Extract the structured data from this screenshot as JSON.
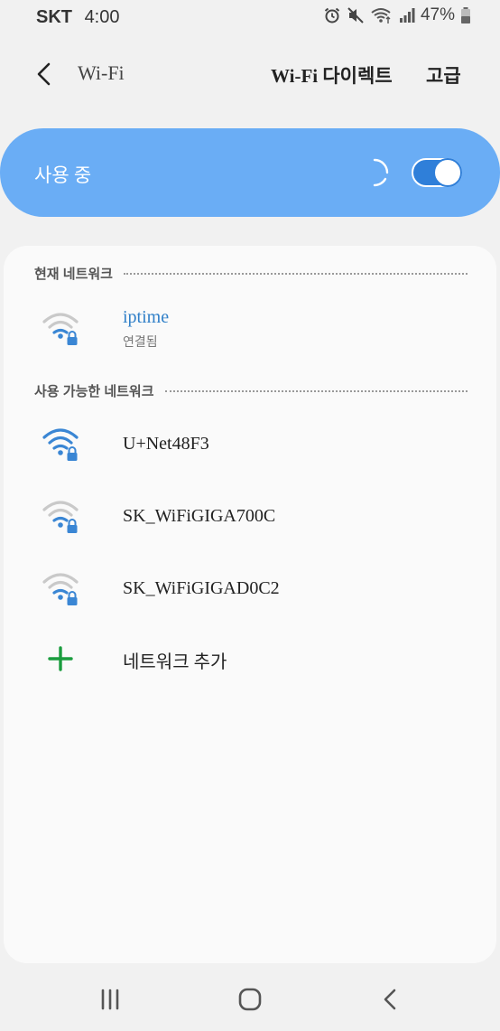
{
  "status_bar": {
    "carrier": "SKT",
    "time": "4:00",
    "battery": "47%",
    "icons": [
      "alarm-icon",
      "mute-icon",
      "wifi-calling-icon",
      "signal-icon",
      "battery-icon"
    ]
  },
  "app_bar": {
    "title": "Wi-Fi",
    "wifi_direct": "Wi-Fi 다이렉트",
    "advanced": "고급"
  },
  "master": {
    "label": "사용 중",
    "enabled": true,
    "accent": "#6aadf5"
  },
  "current_section": {
    "header": "현재 네트워크",
    "network": {
      "name": "iptime",
      "status": "연결됨",
      "secured": true
    }
  },
  "available_section": {
    "header": "사용 가능한 네트워크",
    "networks": [
      {
        "name": "U+Net48F3",
        "secured": true,
        "signal": "full"
      },
      {
        "name": "SK_WiFiGIGA700C",
        "secured": true,
        "signal": "weak"
      },
      {
        "name": "SK_WiFiGIGAD0C2",
        "secured": true,
        "signal": "weak"
      }
    ]
  },
  "add_network": {
    "label": "네트워크 추가",
    "color": "#1a9c3e"
  },
  "nav": {
    "icons": [
      "recent-apps-icon",
      "home-icon",
      "back-icon"
    ]
  }
}
